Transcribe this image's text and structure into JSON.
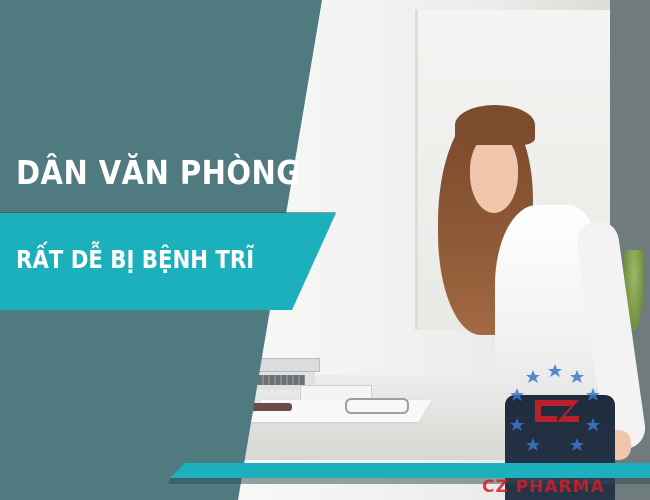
{
  "banner": {
    "headline": "DÂN VĂN PHÒNG",
    "subline": "RẤT DỄ BỊ BỆNH TRĨ"
  },
  "brand": {
    "name": "CZ PHARMA",
    "logo_color": "#d21f2a",
    "star_color": "#3a78c9"
  },
  "colors": {
    "panel_dark": "#4e7a80",
    "accent_teal": "#1bb0bb",
    "shadow": "#2f4a4f"
  },
  "icons": {
    "logo": "cz-pharma-logo-icon"
  }
}
